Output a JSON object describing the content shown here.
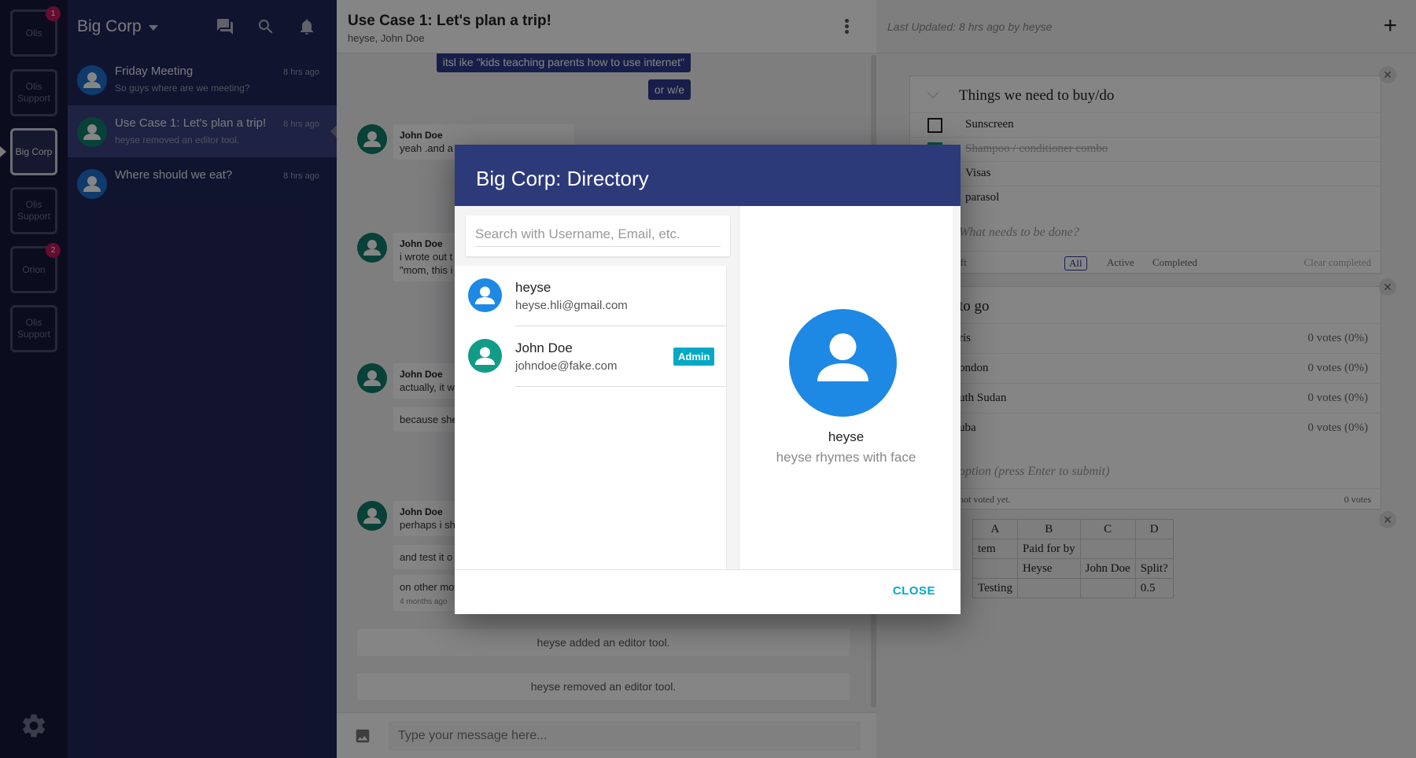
{
  "workspaces": [
    {
      "label": "Olis",
      "badge": "1"
    },
    {
      "label": "Olis Support",
      "badge": ""
    },
    {
      "label": "Big Corp",
      "badge": ""
    },
    {
      "label": "Olis Support",
      "badge": ""
    },
    {
      "label": "Orion",
      "badge": "2"
    },
    {
      "label": "Olis Support",
      "badge": ""
    }
  ],
  "org": {
    "name": "Big Corp"
  },
  "channels": [
    {
      "name": "Friday Meeting",
      "last": "So guys where are we meeting?",
      "time": "8 hrs ago"
    },
    {
      "name": "Use Case 1: Let's plan a trip!",
      "last": "heyse removed an editor tool.",
      "time": "8 hrs ago"
    },
    {
      "name": "Where should we eat?",
      "last": "",
      "time": "8 hrs ago"
    }
  ],
  "chat": {
    "title": "Use Case 1: Let's plan a trip!",
    "members": "heyse, John Doe",
    "outgoing": [
      "itsl ike \"kids teaching parents how to use internet\"",
      "or w/e"
    ],
    "messages": [
      {
        "author": "John Doe",
        "text": "yeah .and a"
      },
      {
        "author": "John Doe",
        "text": "i wrote out t",
        "text2": "\"mom, this i"
      },
      {
        "author": "John Doe",
        "text": "actually, it w",
        "extra": "because she"
      },
      {
        "author": "John Doe",
        "text": "perhaps i sh",
        "extra": "and test it o",
        "extra2": "on other mo",
        "time": "4 months ago"
      }
    ],
    "system": [
      "heyse added an editor tool.",
      "heyse removed an editor tool."
    ],
    "composer_placeholder": "Type your message here..."
  },
  "tools": {
    "last_updated": "Last Updated: 8 hrs ago by heyse",
    "todo": {
      "title": "Things we need to buy/do",
      "items": [
        {
          "label": "Sunscreen",
          "done": false
        },
        {
          "label": "Shampoo / conditioner combo",
          "done": true
        },
        {
          "label": "Visas",
          "done": false
        },
        {
          "label": "parasol",
          "done": false
        }
      ],
      "new_placeholder": "What needs to be done?",
      "left": "eft",
      "filters": [
        "All",
        "Active",
        "Completed"
      ],
      "clear": "Clear completed"
    },
    "poll": {
      "title": "to go",
      "options": [
        {
          "label": "ris",
          "votes": "0 votes (0%)"
        },
        {
          "label": "ondon",
          "votes": "0 votes (0%)"
        },
        {
          "label": "uth Sudan",
          "votes": "0 votes (0%)"
        },
        {
          "label": "uba",
          "votes": "0 votes (0%)"
        }
      ],
      "new_placeholder": "option (press Enter to submit)",
      "status": "not voted yet.",
      "total": "0 votes"
    },
    "sheet": {
      "rows": [
        [
          "A",
          "B",
          "C",
          "D"
        ],
        [
          "tem",
          "Paid for by",
          "",
          ""
        ],
        [
          "",
          "Heyse",
          "John Doe",
          "Split?"
        ],
        [
          "Testing",
          "",
          "",
          "0.5"
        ]
      ]
    }
  },
  "modal": {
    "title": "Big Corp: Directory",
    "search_placeholder": "Search with Username, Email, etc.",
    "users": [
      {
        "name": "heyse",
        "email": "heyse.hli@gmail.com",
        "badge": ""
      },
      {
        "name": "John Doe",
        "email": "johndoe@fake.com",
        "badge": "Admin"
      }
    ],
    "profile": {
      "name": "heyse",
      "bio": "heyse rhymes with face"
    },
    "close_label": "CLOSE"
  }
}
